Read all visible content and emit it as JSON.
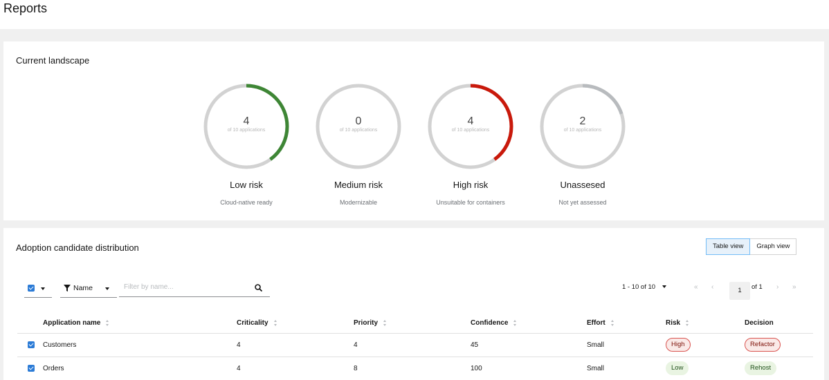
{
  "page": {
    "title": "Reports"
  },
  "landscape": {
    "title": "Current landscape",
    "donuts": [
      {
        "value": "4",
        "subtext": "of 10 applications",
        "label": "Low risk",
        "description": "Cloud-native ready",
        "fraction": 0.4,
        "color": "#3e8635"
      },
      {
        "value": "0",
        "subtext": "of 10 applications",
        "label": "Medium risk",
        "description": "Modernizable",
        "fraction": 0.0,
        "color": "#f0ab00"
      },
      {
        "value": "4",
        "subtext": "of 10 applications",
        "label": "High risk",
        "description": "Unsuitable for containers",
        "fraction": 0.4,
        "color": "#c9190b"
      },
      {
        "value": "2",
        "subtext": "of 10 applications",
        "label": "Unassesed",
        "description": "Not yet assessed",
        "fraction": 0.2,
        "color": "#b8bbbe"
      }
    ],
    "track_color": "#d2d2d2"
  },
  "adoption": {
    "title": "Adoption candidate distribution",
    "views": {
      "table": "Table view",
      "graph": "Graph view",
      "active": "table"
    },
    "filter": {
      "attribute": "Name",
      "placeholder": "Filter by name..."
    },
    "pagination": {
      "range": "1 - 10 of 10",
      "page": "1",
      "of": "of 1"
    },
    "columns": [
      "Application name",
      "Criticality",
      "Priority",
      "Confidence",
      "Effort",
      "Risk",
      "Decision"
    ],
    "rows": [
      {
        "name": "Customers",
        "criticality": "4",
        "priority": "4",
        "confidence": "45",
        "effort": "Small",
        "risk": "High",
        "decision": "Refactor"
      },
      {
        "name": "Orders",
        "criticality": "4",
        "priority": "8",
        "confidence": "100",
        "effort": "Small",
        "risk": "Low",
        "decision": "Rehost"
      }
    ]
  }
}
